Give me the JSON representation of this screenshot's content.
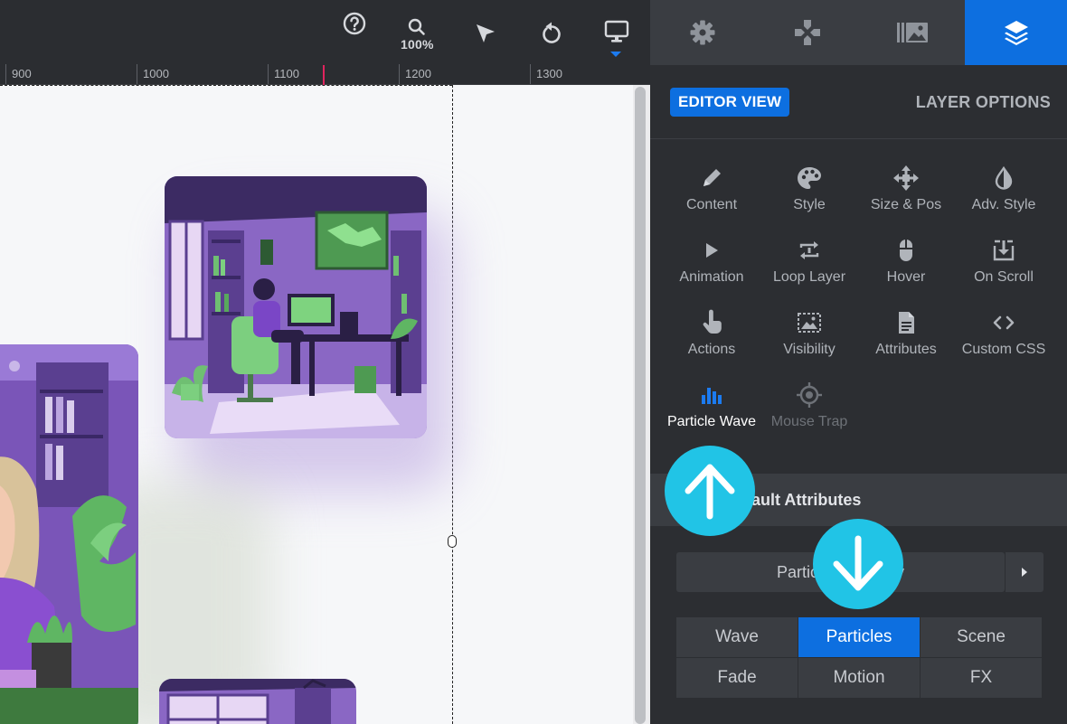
{
  "toolbar": {
    "zoom_label": "100%",
    "icons": [
      "help-icon",
      "zoom-icon",
      "select-pointer-icon",
      "undo-icon",
      "desktop-device-icon"
    ]
  },
  "panel_tabs": [
    {
      "name": "settings",
      "icon": "gear-icon"
    },
    {
      "name": "navigation",
      "icon": "gamepad-icon"
    },
    {
      "name": "media-library",
      "icon": "media-library-icon"
    },
    {
      "name": "layers",
      "icon": "layers-icon",
      "active": true
    }
  ],
  "ruler": {
    "labels": [
      "900",
      "1000",
      "1100",
      "1200",
      "1300"
    ]
  },
  "panel": {
    "editor_view": "EDITOR VIEW",
    "layer_options": "LAYER OPTIONS",
    "options": [
      {
        "label": "Content",
        "icon": "pencil-icon"
      },
      {
        "label": "Style",
        "icon": "palette-icon"
      },
      {
        "label": "Size & Pos",
        "icon": "move-arrows-icon"
      },
      {
        "label": "Adv. Style",
        "icon": "contrast-drop-icon"
      },
      {
        "label": "Animation",
        "icon": "play-icon"
      },
      {
        "label": "Loop Layer",
        "icon": "loop-icon"
      },
      {
        "label": "Hover",
        "icon": "mouse-icon"
      },
      {
        "label": "On Scroll",
        "icon": "download-box-icon"
      },
      {
        "label": "Actions",
        "icon": "hand-pointer-icon"
      },
      {
        "label": "Visibility",
        "icon": "image-dashed-icon"
      },
      {
        "label": "Attributes",
        "icon": "document-icon"
      },
      {
        "label": "Custom CSS",
        "icon": "code-icon"
      },
      {
        "label": "Particle Wave",
        "icon": "bar-chart-icon",
        "active": true
      },
      {
        "label": "Mouse Trap",
        "icon": "crosshair-icon",
        "dim": true
      }
    ],
    "section_title": "e Default Attributes",
    "library_button": "Partic          ibrary",
    "presets": [
      "Wave",
      "Particles",
      "Scene",
      "Fade",
      "Motion",
      "FX"
    ],
    "active_preset": "Particles"
  },
  "colors": {
    "accent": "#0d6fe0",
    "callout": "#21c4e6",
    "panel_bg": "#2c2e32"
  }
}
